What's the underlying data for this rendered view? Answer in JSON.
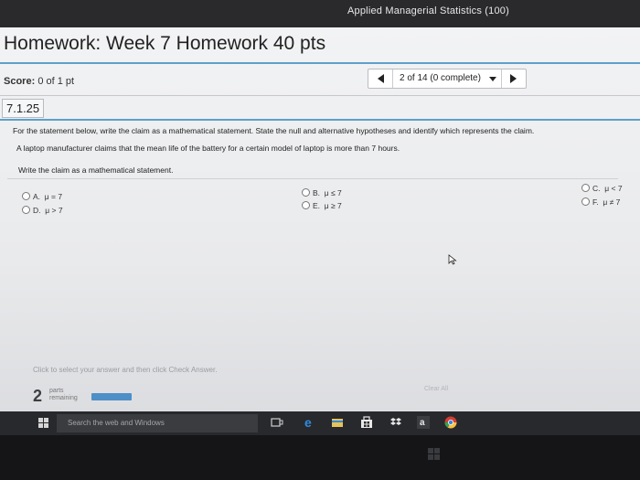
{
  "course": {
    "title": "Applied Managerial Statistics (100)"
  },
  "homework": {
    "title": "Homework: Week 7 Homework 40 pts"
  },
  "score": {
    "label": "Score:",
    "value": "0 of 1 pt"
  },
  "navigation": {
    "count_label": "2 of 14 (0 complete)"
  },
  "question": {
    "number": "7.1.25",
    "instruction": "For the statement below, write the claim as a mathematical statement. State the null and alternative hypotheses and identify which represents the claim.",
    "statement": "A laptop manufacturer claims that the mean life of the battery for a certain model of laptop is more than 7 hours.",
    "prompt": "Write the claim as a mathematical statement."
  },
  "options": [
    {
      "key": "A.",
      "text": "μ = 7"
    },
    {
      "key": "B.",
      "text": "μ ≤ 7"
    },
    {
      "key": "C.",
      "text": "μ < 7"
    },
    {
      "key": "D.",
      "text": "μ > 7"
    },
    {
      "key": "E.",
      "text": "μ ≥ 7"
    },
    {
      "key": "F.",
      "text": "μ ≠ 7"
    }
  ],
  "footer": {
    "hint": "Click to select your answer and then click Check Answer.",
    "parts_count": "2",
    "parts_label_1": "parts",
    "parts_label_2": "remaining",
    "clear_all": "Clear All"
  },
  "taskbar": {
    "search_placeholder": "Search the web and Windows"
  },
  "colors": {
    "accent": "#5ea0c9",
    "progress": "#4d8fc6",
    "taskbar": "#28292c"
  },
  "icons": [
    "windows-start-icon",
    "task-view-icon",
    "edge-icon",
    "file-explorer-icon",
    "store-icon",
    "dropbox-icon",
    "amazon-icon",
    "chrome-icon",
    "mouse-pointer-icon"
  ]
}
